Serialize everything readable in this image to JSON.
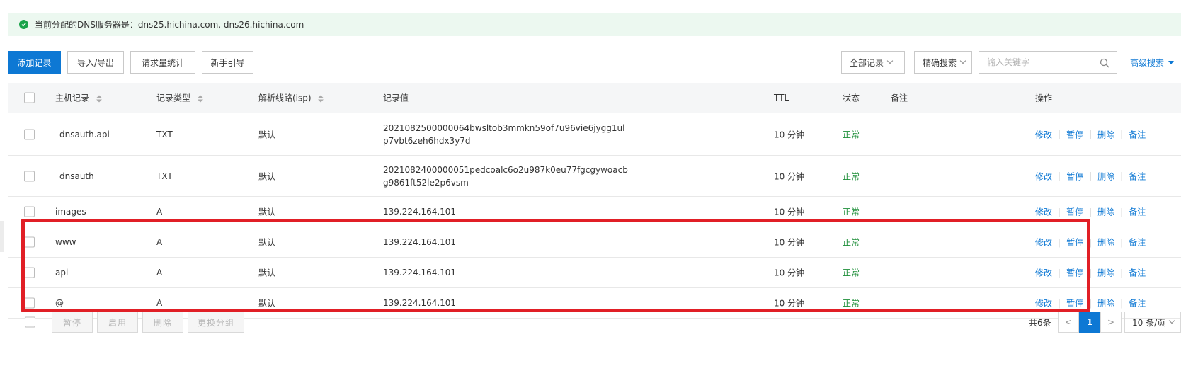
{
  "notice": {
    "text": "当前分配的DNS服务器是：dns25.hichina.com, dns26.hichina.com",
    "icon": "check-circle-icon"
  },
  "toolbar": {
    "add": "添加记录",
    "import_export": "导入/导出",
    "stats": "请求量统计",
    "guide": "新手引导",
    "filter_all": "全部记录",
    "search_mode": "精确搜索",
    "search_placeholder": "输入关键字",
    "advanced": "高级搜索"
  },
  "table": {
    "headers": {
      "host": "主机记录",
      "type": "记录类型",
      "line": "解析线路(isp)",
      "value": "记录值",
      "ttl": "TTL",
      "status": "状态",
      "remark": "备注",
      "ops": "操作"
    },
    "ops": {
      "edit": "修改",
      "pause": "暂停",
      "delete": "删除",
      "remark": "备注"
    },
    "rows": [
      {
        "host": "_dnsauth.api",
        "type": "TXT",
        "line": "默认",
        "value1": "2021082500000064bwsltob3mmkn59of7u96vie6jygg1ul",
        "value2": "p7vbt6zeh6hdx3y7d",
        "ttl": "10 分钟",
        "status": "正常"
      },
      {
        "host": "_dnsauth",
        "type": "TXT",
        "line": "默认",
        "value1": "2021082400000051pedcoalc6o2u987k0eu77fgcgywoacb",
        "value2": "g9861ft52le2p6vsm",
        "ttl": "10 分钟",
        "status": "正常"
      },
      {
        "host": "images",
        "type": "A",
        "line": "默认",
        "value1": "139.224.164.101",
        "value2": "",
        "ttl": "10 分钟",
        "status": "正常"
      },
      {
        "host": "www",
        "type": "A",
        "line": "默认",
        "value1": "139.224.164.101",
        "value2": "",
        "ttl": "10 分钟",
        "status": "正常"
      },
      {
        "host": "api",
        "type": "A",
        "line": "默认",
        "value1": "139.224.164.101",
        "value2": "",
        "ttl": "10 分钟",
        "status": "正常"
      },
      {
        "host": "@",
        "type": "A",
        "line": "默认",
        "value1": "139.224.164.101",
        "value2": "",
        "ttl": "10 分钟",
        "status": "正常"
      }
    ]
  },
  "footer": {
    "pause": "暂停",
    "enable": "启用",
    "delete": "删除",
    "change_group": "更换分组",
    "total": "共6条",
    "prev": "<",
    "page": "1",
    "next": ">",
    "page_size": "10 条/页"
  },
  "colors": {
    "accent": "#0d78d4",
    "success": "#1f8f3a",
    "highlight": "#e11f26"
  }
}
